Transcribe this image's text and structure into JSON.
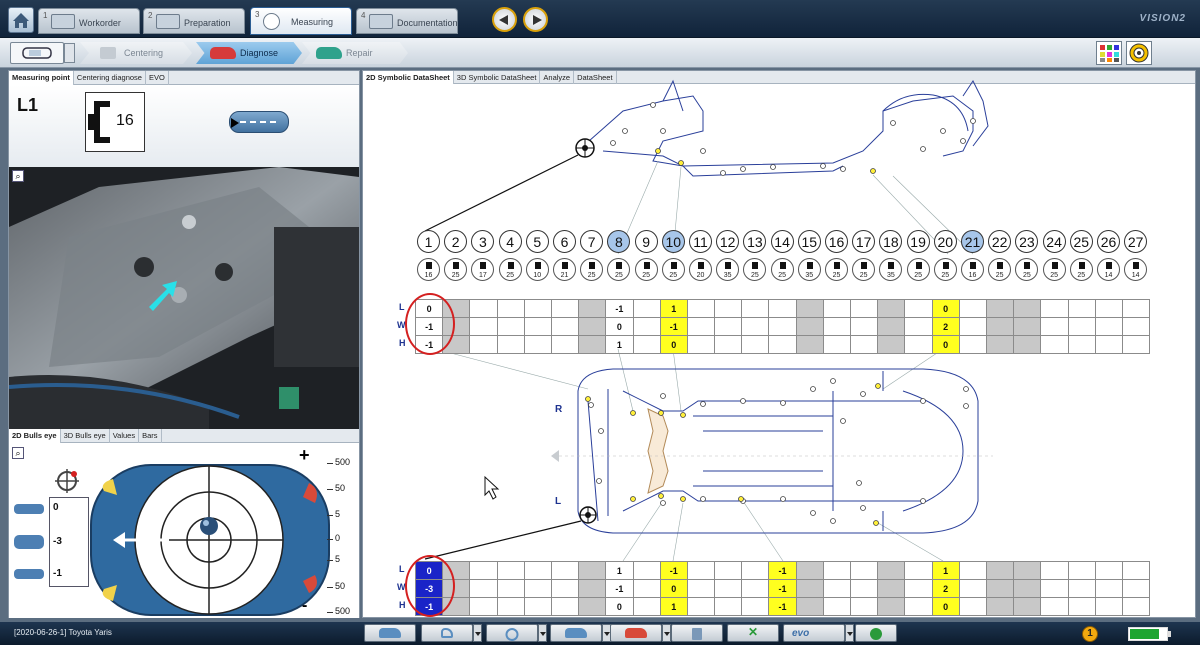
{
  "topbar": {
    "tabs": [
      {
        "num": "1",
        "label": "Workorder"
      },
      {
        "num": "2",
        "label": "Preparation"
      },
      {
        "num": "3",
        "label": "Measuring"
      },
      {
        "num": "4",
        "label": "Documentation"
      }
    ],
    "brand": "VISION2"
  },
  "workflow": {
    "steps": [
      {
        "label": "Centering"
      },
      {
        "label": "Diagnose"
      },
      {
        "label": "Repair"
      }
    ]
  },
  "left": {
    "tabs": [
      "Measuring point",
      "Centering diagnose",
      "EVO"
    ],
    "point_code": "L1",
    "point_size": "16",
    "bulls_tabs": [
      "2D Bulls eye",
      "3D Bulls eye",
      "Values",
      "Bars"
    ],
    "values": {
      "l": "0",
      "w": "-3",
      "h": "-1"
    },
    "scale": [
      "500",
      "50",
      "5",
      "0",
      "5",
      "50",
      "500"
    ],
    "plus": "+",
    "minus": "-"
  },
  "right": {
    "tabs": [
      "2D Symbolic DataSheet",
      "3D Symbolic DataSheet",
      "Analyze",
      "DataSheet"
    ],
    "points": [
      "1",
      "2",
      "3",
      "4",
      "5",
      "6",
      "7",
      "8",
      "9",
      "10",
      "11",
      "12",
      "13",
      "14",
      "15",
      "16",
      "17",
      "18",
      "19",
      "20",
      "21",
      "22",
      "23",
      "24",
      "25",
      "26",
      "27"
    ],
    "selected_points": [
      "8",
      "10",
      "21"
    ],
    "symbol_sizes": [
      "16",
      "25",
      "17",
      "25",
      "10",
      "21",
      "25",
      "25",
      "25",
      "25",
      "20",
      "35",
      "25",
      "25",
      "35",
      "25",
      "25",
      "35",
      "25",
      "25",
      "16",
      "25",
      "25",
      "25",
      "25",
      "14",
      "14"
    ],
    "row_labels": [
      "L",
      "W",
      "H"
    ],
    "side_labels": {
      "r": "R",
      "l": "L"
    },
    "top_grid": [
      [
        "0",
        "",
        "",
        "",
        "",
        "",
        "",
        "-1",
        "",
        "1",
        "",
        "",
        "",
        "",
        "",
        "",
        "",
        "",
        "",
        "0",
        "",
        "",
        "",
        "",
        "",
        "",
        ""
      ],
      [
        "-1",
        "",
        "",
        "",
        "",
        "",
        "",
        "0",
        "",
        "-1",
        "",
        "",
        "",
        "",
        "",
        "",
        "",
        "",
        "",
        "2",
        "",
        "",
        "",
        "",
        "",
        "",
        ""
      ],
      [
        "-1",
        "",
        "",
        "",
        "",
        "",
        "",
        "1",
        "",
        "0",
        "",
        "",
        "",
        "",
        "",
        "",
        "",
        "",
        "",
        "0",
        "",
        "",
        "",
        "",
        "",
        "",
        ""
      ]
    ],
    "bottom_grid": [
      [
        "0",
        "",
        "",
        "",
        "",
        "",
        "",
        "1",
        "",
        "-1",
        "",
        "",
        "",
        "-1",
        "",
        "",
        "",
        "",
        "",
        "1",
        "",
        "",
        "",
        "",
        "",
        "",
        ""
      ],
      [
        "-3",
        "",
        "",
        "",
        "",
        "",
        "",
        "-1",
        "",
        "0",
        "",
        "",
        "",
        "-1",
        "",
        "",
        "",
        "",
        "",
        "2",
        "",
        "",
        "",
        "",
        "",
        "",
        ""
      ],
      [
        "-1",
        "",
        "",
        "",
        "",
        "",
        "",
        "0",
        "",
        "1",
        "",
        "",
        "",
        "-1",
        "",
        "",
        "",
        "",
        "",
        "0",
        "",
        "",
        "",
        "",
        "",
        "",
        ""
      ]
    ]
  },
  "status": {
    "job": "[2020-06-26-1] Toyota Yaris",
    "evo_label": "evo",
    "warn_count": "1",
    "battery_level": 0.75
  },
  "colors": {
    "accent": "#5fa3d6",
    "highlight": "#ffff1f",
    "selected_cell": "#1a24c8",
    "annotation": "#d42020"
  }
}
